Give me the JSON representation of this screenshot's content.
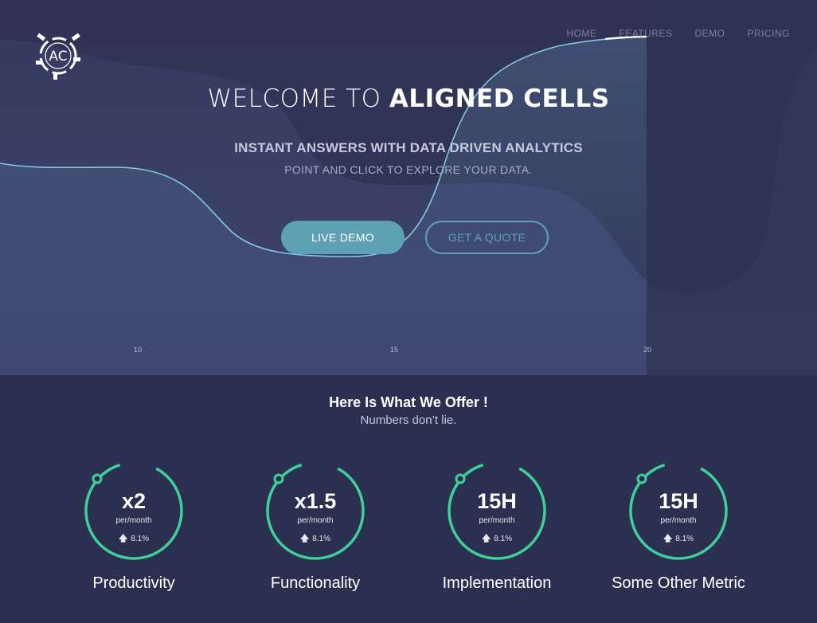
{
  "nav": {
    "items": [
      "HOME",
      "FEATURES",
      "DEMO",
      "PRICING"
    ]
  },
  "logo": {
    "text": "AC"
  },
  "hero": {
    "title_light": "WELCOME TO ",
    "title_bold": "ALIGNED CELLS",
    "subtitle": "INSTANT ANSWERS WITH DATA DRIVEN ANALYTICS",
    "subtitle2": "POINT AND CLICK TO EXPLORE YOUR DATA.",
    "live_demo_label": "LIVE DEMO",
    "quote_label": "GET A QUOTE",
    "axis_ticks": [
      "10",
      "15",
      "20"
    ]
  },
  "offer": {
    "title": "Here Is What We Offer !",
    "subtitle": "Numbers don’t lie.",
    "metrics": [
      {
        "value": "x2",
        "unit": "per/month",
        "change": "8.1%",
        "label": "Productivity"
      },
      {
        "value": "x1.5",
        "unit": "per/month",
        "change": "8.1%",
        "label": "Functionality"
      },
      {
        "value": "15H",
        "unit": "per/month",
        "change": "8.1%",
        "label": "Implementation"
      },
      {
        "value": "15H",
        "unit": "per/month",
        "change": "8.1%",
        "label": "Some Other Metric"
      }
    ]
  },
  "colors": {
    "accent": "#5fa1b4",
    "ring": "#3ecf9b",
    "hero_bg": "#3a4068",
    "section_bg": "#2c3050"
  }
}
